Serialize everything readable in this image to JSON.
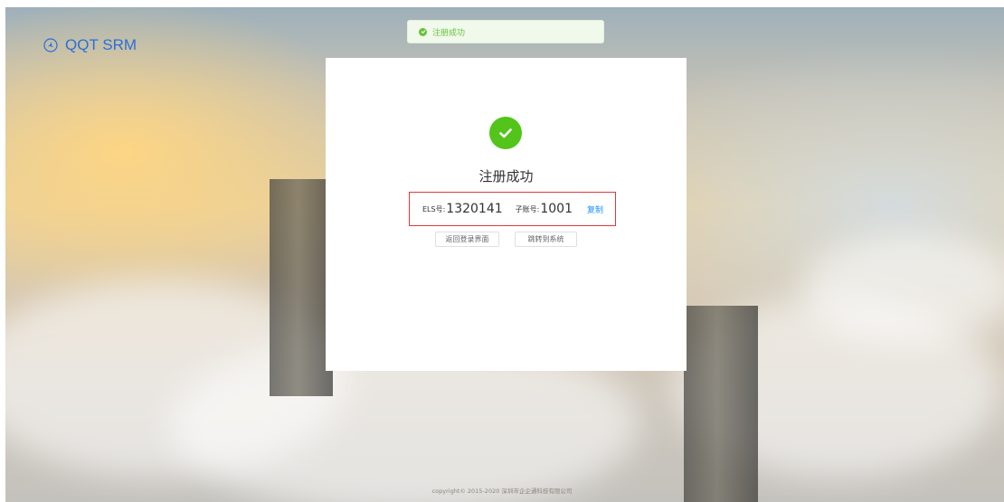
{
  "app": {
    "logo_text": "QQT SRM",
    "logo_icon": "propeller-logo-icon"
  },
  "toast": {
    "text": "注册成功",
    "icon": "check-circle-icon",
    "color": "#67c23a"
  },
  "result": {
    "title": "注册成功",
    "icon": "check-circle-icon",
    "els_label": "ELS号:",
    "els_value": "1320141",
    "sub_label": "子账号:",
    "sub_value": "1001",
    "copy_label": "复制"
  },
  "actions": {
    "back_to_login": "返回登录界面",
    "go_to_system": "跳转到系统"
  },
  "footer": {
    "text": "copyright© 2015-2020 深圳市企企通科技有限公司"
  },
  "colors": {
    "success": "#52c41a",
    "link": "#1890ff",
    "highlight_border": "#e0393e",
    "brand": "#2b6fd6"
  }
}
